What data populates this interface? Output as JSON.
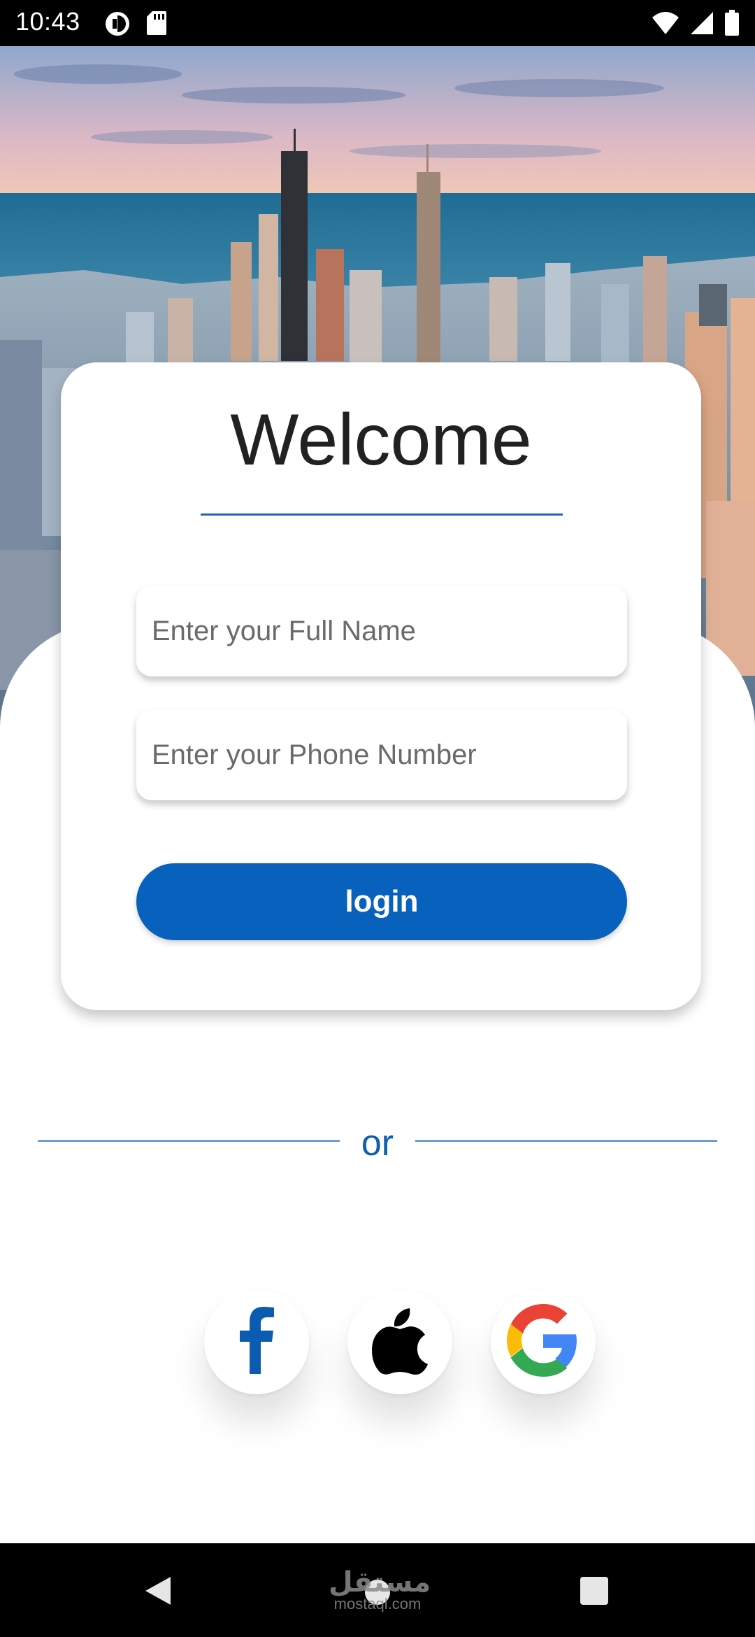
{
  "status_bar": {
    "time": "10:43",
    "left_icons": [
      "data-saver-icon",
      "sd-card-icon"
    ],
    "right_icons": [
      "wifi-icon",
      "signal-icon",
      "battery-icon"
    ]
  },
  "card": {
    "title": "Welcome",
    "name_placeholder": "Enter your Full Name",
    "phone_placeholder": "Enter your Phone Number",
    "login_label": "login"
  },
  "divider": {
    "text": "or"
  },
  "social": [
    {
      "name": "facebook",
      "icon": "facebook-icon"
    },
    {
      "name": "apple",
      "icon": "apple-icon"
    },
    {
      "name": "google",
      "icon": "google-icon"
    }
  ],
  "nav_bar": {
    "watermark_ar": "مستقل",
    "watermark_en": "mostaql.com",
    "icons": [
      "back-icon",
      "home-icon",
      "recents-icon"
    ]
  },
  "colors": {
    "accent": "#0861bd",
    "divider": "#3f84c8",
    "title": "#212121"
  }
}
